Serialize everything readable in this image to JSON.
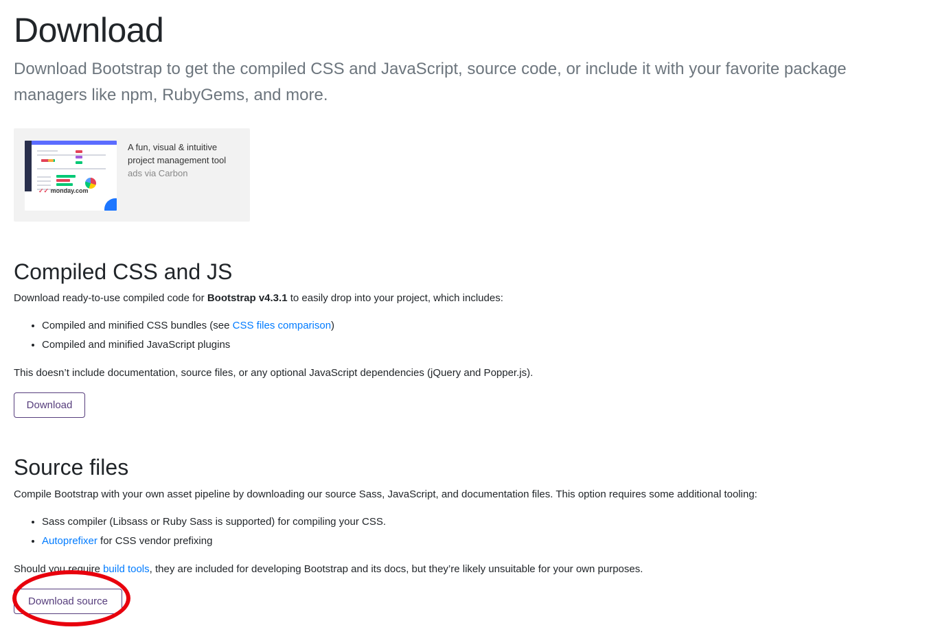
{
  "header": {
    "title": "Download",
    "lead": "Download Bootstrap to get the compiled CSS and JavaScript, source code, or include it with your favorite package managers like npm, RubyGems, and more."
  },
  "ad": {
    "text": "A fun, visual & intuitive project management tool",
    "via": "ads via Carbon",
    "image_brand": "monday.com"
  },
  "compiled": {
    "heading": "Compiled CSS and JS",
    "intro_before": "Download ready-to-use compiled code for ",
    "intro_bold": "Bootstrap v4.3.1",
    "intro_after": " to easily drop into your project, which includes:",
    "items": [
      {
        "before": "Compiled and minified CSS bundles (see ",
        "link": "CSS files comparison",
        "after": ")"
      },
      {
        "text": "Compiled and minified JavaScript plugins"
      }
    ],
    "note": "This doesn’t include documentation, source files, or any optional JavaScript dependencies (jQuery and Popper.js).",
    "button_label": "Download"
  },
  "source": {
    "heading": "Source files",
    "intro": "Compile Bootstrap with your own asset pipeline by downloading our source Sass, JavaScript, and documentation files. This option requires some additional tooling:",
    "items": [
      {
        "text": "Sass compiler (Libsass or Ruby Sass is supported) for compiling your CSS."
      },
      {
        "link": "Autoprefixer",
        "after": " for CSS vendor prefixing"
      }
    ],
    "note_before": "Should you require ",
    "note_link": "build tools",
    "note_after": ", they are included for developing Bootstrap and its docs, but they’re likely unsuitable for your own purposes.",
    "button_label": "Download source"
  },
  "colors": {
    "link": "#007bff",
    "button_outline": "#563d7c",
    "annotation": "#e8000d"
  }
}
